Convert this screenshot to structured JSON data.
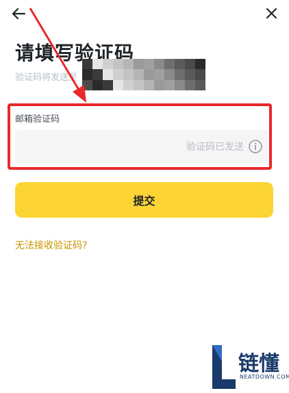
{
  "header": {
    "back_icon": "back-arrow-icon",
    "close_icon": "close-icon"
  },
  "title": "请填写验证码",
  "subtitle": "验证码将发送至",
  "field": {
    "label": "邮箱验证码",
    "status": "验证码已发送",
    "info_icon": "info-icon"
  },
  "submit_label": "提交",
  "help_link": "无法接收验证码?",
  "watermark": {
    "text": "链懂",
    "sub": "NEATDOWN.COM"
  },
  "colors": {
    "primary": "#fcd535",
    "link": "#c99400",
    "highlight": "#e8282b",
    "watermark": "#1a3a6b"
  }
}
